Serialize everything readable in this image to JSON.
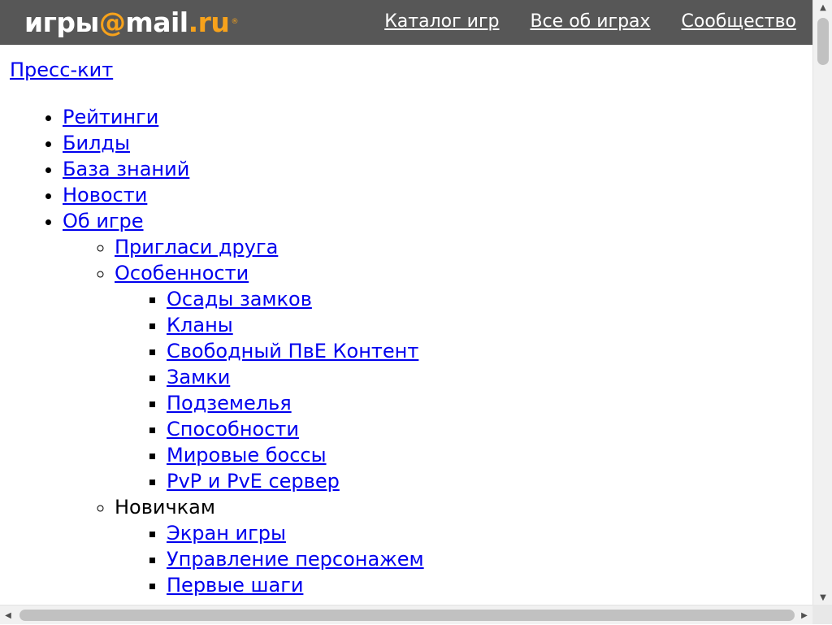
{
  "header": {
    "logo": {
      "part1": "игры",
      "at": "@",
      "part2": "mail",
      "dot": ".",
      "part3": "ru",
      "reg": "®"
    },
    "nav": [
      {
        "label": "Каталог игр"
      },
      {
        "label": "Все об играх"
      },
      {
        "label": "Сообщество"
      }
    ]
  },
  "press_kit": "Пресс-кит",
  "menu": {
    "ratings": "Рейтинги",
    "builds": "Билды",
    "knowledge": "База знаний",
    "news": "Новости",
    "about": "Об игре",
    "invite": "Пригласи друга",
    "features": "Особенности",
    "features_items": [
      "Осады замков",
      "Кланы",
      "Свободный ПвЕ Контент",
      "Замки",
      "Подземелья",
      "Способности",
      "Мировые боссы",
      "PvP и PvE сервер"
    ],
    "newbies": "Новичкам",
    "newbies_items": [
      "Экран игры",
      "Управление персонажем",
      "Первые шаги"
    ]
  },
  "colors": {
    "header_bg": "#575757",
    "logo_accent": "#f7a21b",
    "link": "#0000ee"
  }
}
